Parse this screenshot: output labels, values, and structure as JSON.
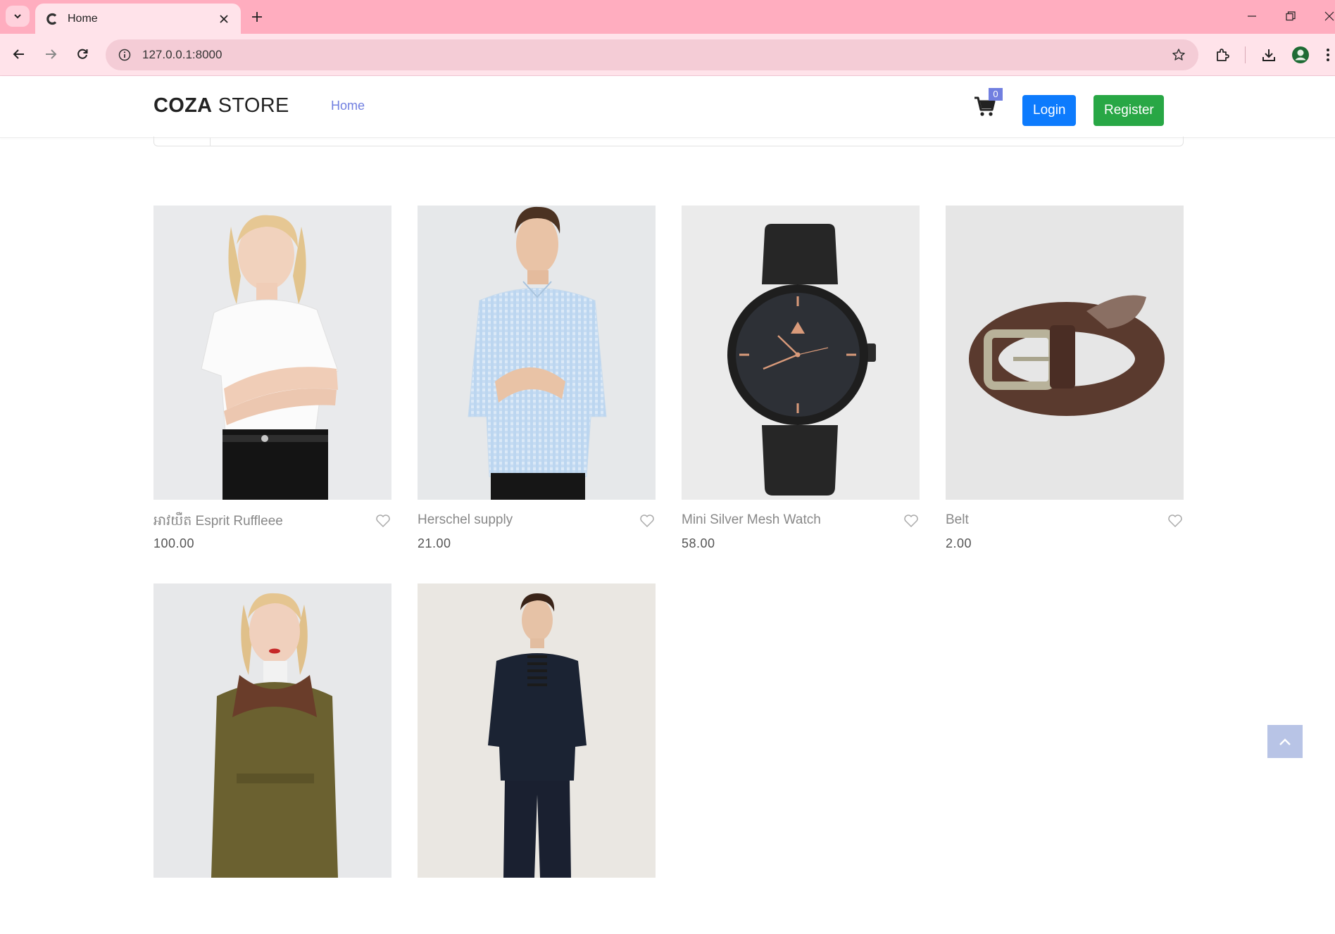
{
  "browser": {
    "tab_title": "Home",
    "url": "127.0.0.1:8000"
  },
  "header": {
    "logo_bold": "COZA",
    "logo_light": "STORE",
    "nav_home": "Home",
    "cart_count": "0",
    "login_label": "Login",
    "register_label": "Register"
  },
  "products": [
    {
      "name": "អាវយឺត Esprit Ruffleee",
      "price": "100.00"
    },
    {
      "name": "Herschel supply",
      "price": "21.00"
    },
    {
      "name": "Mini Silver Mesh Watch",
      "price": "58.00"
    },
    {
      "name": "Belt",
      "price": "2.00"
    },
    {
      "name": "",
      "price": ""
    },
    {
      "name": "",
      "price": ""
    }
  ],
  "colors": {
    "accent": "#717fe0",
    "login": "#0d7bfd",
    "register": "#28a745",
    "chrome_tabbar": "#ffadbf"
  }
}
